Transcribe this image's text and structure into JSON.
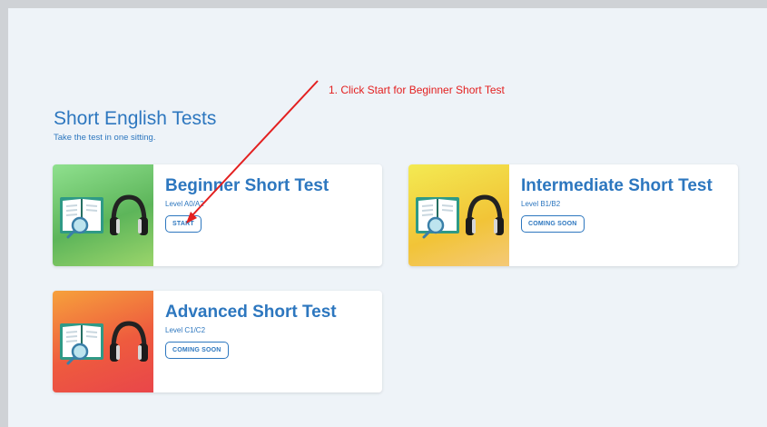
{
  "section": {
    "title": "Short English Tests",
    "subtitle": "Take the test in one sitting."
  },
  "tests": [
    {
      "title": "Beginner Short Test",
      "level": "Level A0/A2",
      "button": "START",
      "gradient": "beginner"
    },
    {
      "title": "Intermediate Short Test",
      "level": "Level B1/B2",
      "button": "COMING SOON",
      "gradient": "intermediate"
    },
    {
      "title": "Advanced Short Test",
      "level": "Level C1/C2",
      "button": "COMING SOON",
      "gradient": "advanced"
    }
  ],
  "annotation": {
    "text": "1. Click Start for Beginner Short Test",
    "color": "#e32020"
  },
  "colors": {
    "accent": "#2d77bf",
    "background": "#eef3f8"
  },
  "icons": {
    "book": "open-book-icon",
    "magnifier": "magnifier-icon",
    "headphones": "headphones-icon"
  }
}
